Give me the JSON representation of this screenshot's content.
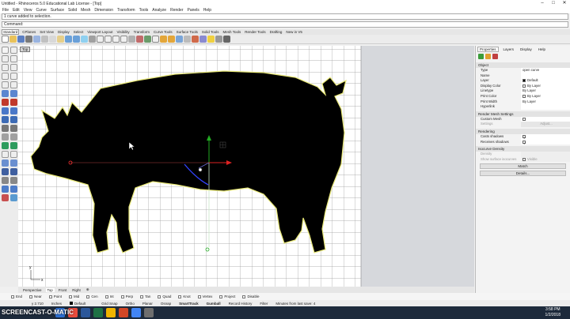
{
  "window": {
    "title": "Untitled - Rhinoceros 5.0 Educational Lab License - [Top]"
  },
  "menu": [
    "File",
    "Edit",
    "View",
    "Curve",
    "Surface",
    "Solid",
    "Mesh",
    "Dimension",
    "Transform",
    "Tools",
    "Analyze",
    "Render",
    "Panels",
    "Help"
  ],
  "command": {
    "history": "1 curve added to selection.",
    "prompt": "Command:"
  },
  "toolbar_tabs": [
    "Standard",
    "CPlanes",
    "Set View",
    "Display",
    "Select",
    "Viewport Layout",
    "Visibility",
    "Transform",
    "Curve Tools",
    "Surface Tools",
    "Solid Tools",
    "Mesh Tools",
    "Render Tools",
    "Drafting",
    "New in V5"
  ],
  "viewport": {
    "label": "Top",
    "axis_x": "x",
    "axis_y": "y"
  },
  "viewport_tabs": [
    "Perspective",
    "Top",
    "Front",
    "Right"
  ],
  "osnap": [
    "End",
    "Near",
    "Point",
    "Mid",
    "Cen",
    "Int",
    "Perp",
    "Tan",
    "Quad",
    "Knot",
    "Vertex",
    "Project",
    "Disable"
  ],
  "status": {
    "coords": "y 2.710",
    "units": "Inches",
    "layer": "Default",
    "items": [
      "Grid Snap",
      "Ortho",
      "Planar",
      "Osnap",
      "SmartTrack",
      "Gumball",
      "Record History",
      "Filter"
    ],
    "message": "Minutes from last save: 4"
  },
  "panel": {
    "tabs": [
      "Properties",
      "Layers",
      "Display",
      "Help"
    ],
    "object_header": "Object",
    "props": [
      {
        "key": "Type",
        "value": "open curve"
      },
      {
        "key": "Name",
        "value": ""
      },
      {
        "key": "Layer",
        "value": "Default",
        "swatch": "#000000"
      },
      {
        "key": "Display Color",
        "value": "By Layer",
        "swatch": "#ffffff"
      },
      {
        "key": "Linetype",
        "value": "By Layer"
      },
      {
        "key": "Print Color",
        "value": "By Layer",
        "swatch": "#ffffff"
      },
      {
        "key": "Print Width",
        "value": "By Layer"
      },
      {
        "key": "Hyperlink",
        "value": ""
      }
    ],
    "render_mesh_header": "Render Mesh Settings",
    "custom_mesh": "Custom Mesh",
    "settings_label": "Settings",
    "adjust_button": "Adjust...",
    "rendering_header": "Rendering",
    "casts_shadows": "Casts shadows",
    "receives_shadows": "Receives shadows",
    "isocurve_header": "Isocurve Density",
    "density_label": "Density",
    "show_isocurves": "Show surface isocurves",
    "visible_label": "Visible",
    "match_button": "Match",
    "details_button": "Details..."
  },
  "taskbar": {
    "time": "3:58 PM",
    "date": "1/2/2018"
  },
  "watermark": "SCREENCAST-O-MATIC",
  "colors": {
    "accent": "#3a6fd8",
    "grid": "#9a9a9a",
    "curve": "#e8e878"
  }
}
